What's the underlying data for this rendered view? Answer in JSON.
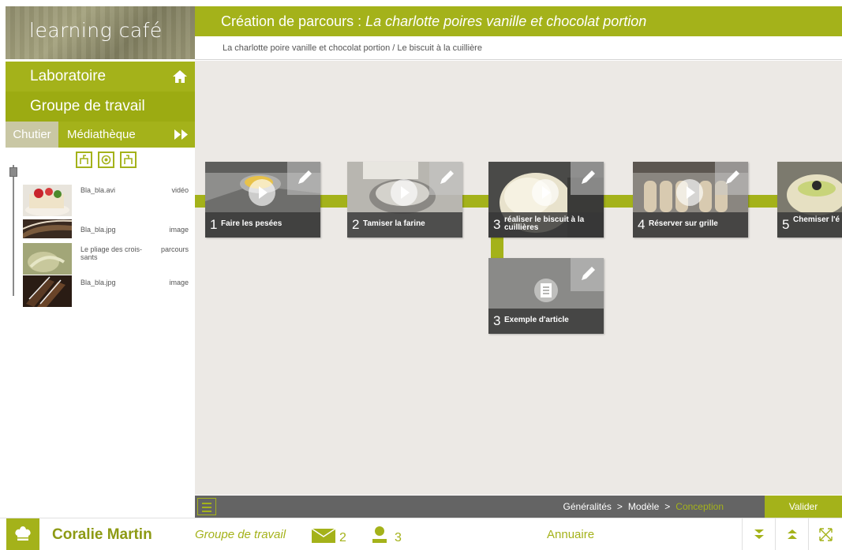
{
  "app": {
    "logo_text": "learning café"
  },
  "sidebar": {
    "nav": {
      "laboratoire": "Laboratoire",
      "groupe": "Groupe de travail"
    },
    "tabs": {
      "chutier": "Chutier",
      "mediatheque": "Médiathèque"
    },
    "files": [
      {
        "name": "Bla_bla.avi",
        "type": "vidéo"
      },
      {
        "name": "Bla_bla.jpg",
        "type": "image"
      },
      {
        "name": "Le pliage des crois-sants",
        "type": "parcours"
      },
      {
        "name": "Bla_bla.jpg",
        "type": "image"
      }
    ]
  },
  "header": {
    "title_prefix": "Création de parcours : ",
    "title_italic": "La charlotte poires vanille et chocolat portion",
    "breadcrumb": "La charlotte poire vanille et chocolat portion / Le biscuit à la cuillière"
  },
  "cards": [
    {
      "num": "1",
      "title": "Faire les pesées",
      "media": "video"
    },
    {
      "num": "2",
      "title": "Tamiser la farine",
      "media": "video"
    },
    {
      "num": "3",
      "title": "réaliser le biscuit à la cuillières",
      "media": "video"
    },
    {
      "num": "4",
      "title": "Réserver sur grille",
      "media": "video"
    },
    {
      "num": "5",
      "title": "Chemiser l'é et détailler",
      "media": "video"
    },
    {
      "num": "3",
      "title": "Exemple d'article",
      "media": "article"
    }
  ],
  "status": {
    "steps": [
      "Généralités",
      "Modèle",
      "Conception"
    ],
    "separator": ">",
    "active_step": "Conception",
    "valider": "Valider"
  },
  "footer": {
    "user_name": "Coralie Martin",
    "group_link": "Groupe de travail",
    "messages_count": "2",
    "users_count": "3",
    "annuaire": "Annuaire"
  },
  "colors": {
    "accent": "#a4b21a",
    "dark_bar": "#646464",
    "canvas_bg": "#ece9e5"
  }
}
